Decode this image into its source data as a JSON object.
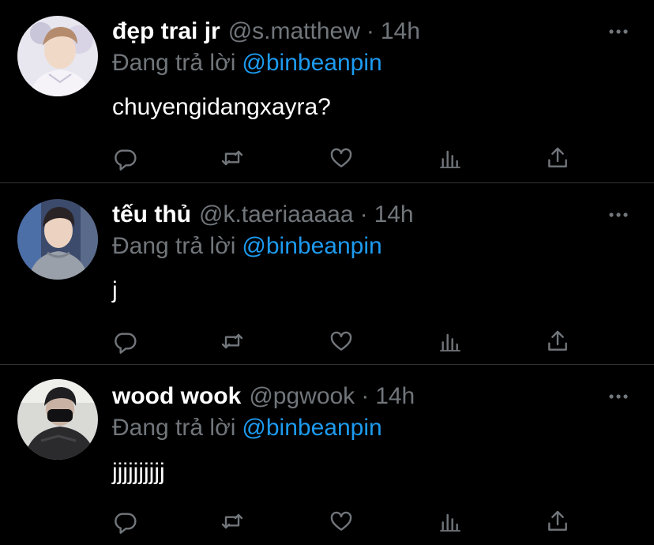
{
  "colors": {
    "background": "#000000",
    "primary_text": "#ffffff",
    "secondary_text": "#71767b",
    "mention": "#1d9bf0",
    "divider": "#2f3336"
  },
  "icons": [
    "more-icon",
    "reply-icon",
    "retweet-icon",
    "like-icon",
    "views-icon",
    "share-icon"
  ],
  "tweets": [
    {
      "display_name": "đẹp trai jr",
      "handle": "@s.matthew",
      "separator": "·",
      "time": "14h",
      "replying_prefix": "Đang trả lời",
      "replying_to": "@binbeanpin",
      "text": "chuyengidangxayra?"
    },
    {
      "display_name": "tếu thủ",
      "handle": "@k.taeriaaaaa",
      "separator": "·",
      "time": "14h",
      "replying_prefix": "Đang trả lời",
      "replying_to": "@binbeanpin",
      "text": "j"
    },
    {
      "display_name": "wood wook",
      "handle": "@pgwook",
      "separator": "·",
      "time": "14h",
      "replying_prefix": "Đang trả lời",
      "replying_to": "@binbeanpin",
      "text": "jjjjjjjjjj"
    }
  ]
}
